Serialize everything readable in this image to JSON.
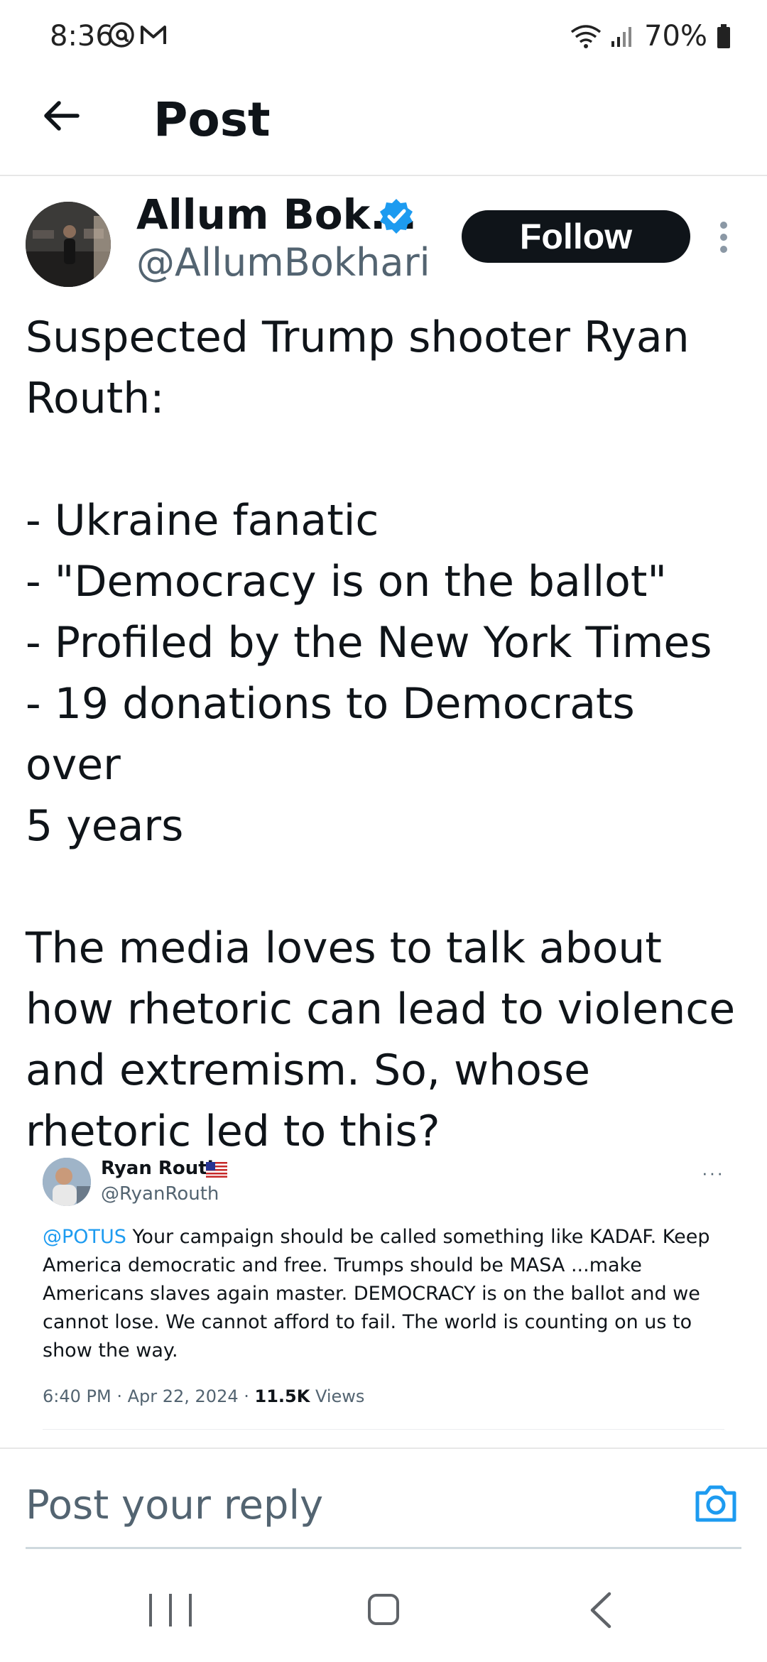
{
  "status_bar": {
    "time": "8:36",
    "battery": "70%",
    "icons": [
      "threads-icon",
      "gmail-icon",
      "wifi-icon",
      "signal-icon",
      "battery-icon"
    ]
  },
  "header": {
    "title": "Post",
    "back_icon": "arrow-left-icon"
  },
  "post": {
    "author_name": "Allum Bok...",
    "author_handle": "@AllumBokhari",
    "verified": true,
    "follow_label": "Follow",
    "text_lines": [
      "Suspected Trump shooter Ryan",
      "Routh:",
      "",
      "- Ukraine fanatic",
      "- \"Democracy is on the ballot\"",
      "- Profiled by the New York Times",
      "- 19 donations to Democrats over",
      "5 years",
      "",
      "The media loves to talk about",
      "how rhetoric can lead to violence",
      "and extremism. So, whose",
      "rhetoric led to this?"
    ]
  },
  "quoted": {
    "name": "Ryan Routh",
    "handle": "@RyanRouth",
    "more": "···",
    "mention": "@POTUS",
    "text": " Your campaign should be called something like KADAF. Keep America democratic and free. Trumps should be MASA ...make Americans slaves again master. DEMOCRACY is on the ballot and we cannot lose. We cannot afford to fail. The world is counting on us to show the way.",
    "timestamp": "6:40 PM · Apr 22, 2024 · ",
    "views_count": "11.5K",
    "views_label": " Views"
  },
  "reply": {
    "placeholder": "Post your reply"
  },
  "colors": {
    "accent": "#1d9bf0",
    "text": "#0f1419",
    "secondary": "#536471",
    "follow_bg": "#0f1419"
  }
}
